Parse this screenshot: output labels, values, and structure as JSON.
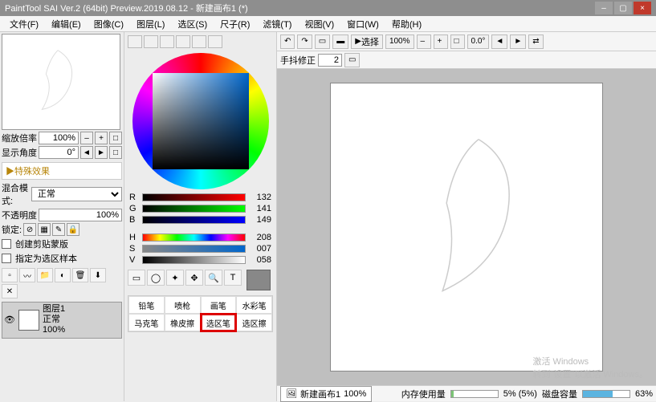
{
  "titlebar": {
    "title": "PaintTool SAI Ver.2 (64bit) Preview.2019.08.12 - 新建画布1 (*)"
  },
  "menu": {
    "file": "文件(F)",
    "edit": "编辑(E)",
    "image": "图像(C)",
    "layer": "图层(L)",
    "select": "选区(S)",
    "ruler": "尺子(R)",
    "filter": "滤镜(T)",
    "view": "视图(V)",
    "window": "窗口(W)",
    "help": "帮助(H)"
  },
  "left": {
    "zoom_label": "缩放倍率",
    "zoom_value": "100%",
    "angle_label": "显示角度",
    "angle_value": "0°",
    "effects": "▶特殊效果",
    "blend_label": "混合模式:",
    "blend_value": "正常",
    "opacity_label": "不透明度",
    "opacity_value": "100%",
    "lock_label": "锁定:",
    "clipping": "创建剪贴蒙版",
    "sample": "指定为选区样本",
    "layer": {
      "name": "图层1",
      "mode": "正常",
      "opacity": "100%"
    }
  },
  "color": {
    "r_label": "R",
    "r": "132",
    "g_label": "G",
    "g": "141",
    "b_label": "B",
    "b": "149",
    "h_label": "H",
    "h": "208",
    "s_label": "S",
    "s": "007",
    "v_label": "V",
    "v": "058"
  },
  "brushes": {
    "b0": "铅笔",
    "b1": "喷枪",
    "b2": "画笔",
    "b3": "水彩笔",
    "b4": "马克笔",
    "b5": "橡皮擦",
    "b6": "选区笔",
    "b7": "选区擦"
  },
  "toolbar": {
    "select_label": "选择",
    "zoom": "100%",
    "rotation": "0.0°",
    "stabilizer_label": "手抖修正",
    "stabilizer_value": "2"
  },
  "status": {
    "doc_name": "新建画布1",
    "doc_zoom": "100%",
    "mem_label": "内存使用量",
    "mem_value": "5% (5%)",
    "disk_label": "磁盘容量",
    "disk_value": "63%"
  },
  "watermark": {
    "line1": "激活 Windows",
    "line2": "转到\"设置\"以激活 Windows。"
  }
}
